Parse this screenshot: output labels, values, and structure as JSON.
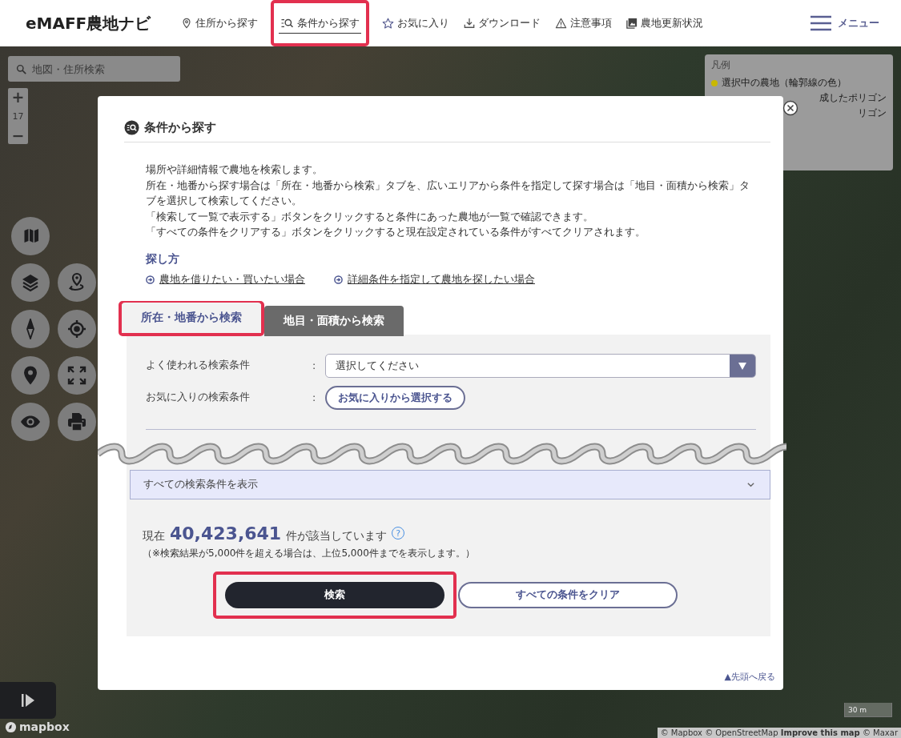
{
  "header": {
    "logo": "eMAFF農地ナビ",
    "nav": [
      {
        "label": "住所から探す",
        "selected": false,
        "highlighted": false
      },
      {
        "label": "条件から探す",
        "selected": true,
        "highlighted": true
      },
      {
        "label": "お気に入り",
        "selected": false,
        "highlighted": false
      },
      {
        "label": "ダウンロード",
        "selected": false,
        "highlighted": false
      },
      {
        "label": "注意事項",
        "selected": false,
        "highlighted": false
      },
      {
        "label": "農地更新状況",
        "selected": false,
        "highlighted": false
      }
    ],
    "menu": "メニュー"
  },
  "map": {
    "search": {
      "placeholder": "地図・住所検索"
    },
    "zoom": {
      "in": "+",
      "level": "17",
      "out": "−"
    },
    "legend": {
      "title": "凡例",
      "items": [
        {
          "label": "選択中の農地（輪郭線の色）",
          "color": "#c9b800"
        },
        {
          "label": "成したポリゴン"
        },
        {
          "label": "リゴン"
        }
      ]
    },
    "logo": "mapbox",
    "scale": "30 m",
    "attribution": "© Mapbox © OpenStreetMap **Improve this map** © Maxar"
  },
  "dialog": {
    "title": "条件から探す",
    "paragraphs": [
      "場所や詳細情報で農地を検索します。",
      "所在・地番から探す場合は「所在・地番から検索」タブを、広いエリアから条件を指定して探す場合は「地目・面積から検索」タブを選択して検索してください。",
      "「検索して一覧で表示する」ボタンをクリックすると条件にあった農地が一覧で確認できます。",
      "「すべての条件をクリアする」ボタンをクリックすると現在設定されている条件がすべてクリアされます。"
    ],
    "howto": {
      "heading": "探し方",
      "links": [
        "農地を借りたい・買いたい場合",
        "詳細条件を指定して農地を探したい場合"
      ]
    },
    "tabs": [
      {
        "label": "所在・地番から検索",
        "selected": true,
        "highlighted": true
      },
      {
        "label": "地目・面積から検索",
        "selected": false,
        "highlighted": false
      }
    ],
    "fields": [
      {
        "label": "よく使われる検索条件",
        "separator": ":",
        "kind": "select",
        "value": "選択してください"
      },
      {
        "label": "お気に入りの検索条件",
        "separator": ":",
        "kind": "button",
        "value": "お気に入りから選択する"
      }
    ],
    "accordion": {
      "label": "すべての検索条件を表示",
      "expanded": false
    },
    "count": {
      "prefix": "現在",
      "number": "40,423,641",
      "suffix": "件が該当しています",
      "help": "?"
    },
    "note": "（※検索結果が5,000件を超える場合は、上位5,000件までを表示します。）",
    "buttons": [
      {
        "label": "検索",
        "kind": "primary",
        "highlighted": true
      },
      {
        "label": "すべての条件をクリア",
        "kind": "secondary",
        "highlighted": false
      }
    ],
    "back_to_top": "▲先頭へ戻る"
  }
}
